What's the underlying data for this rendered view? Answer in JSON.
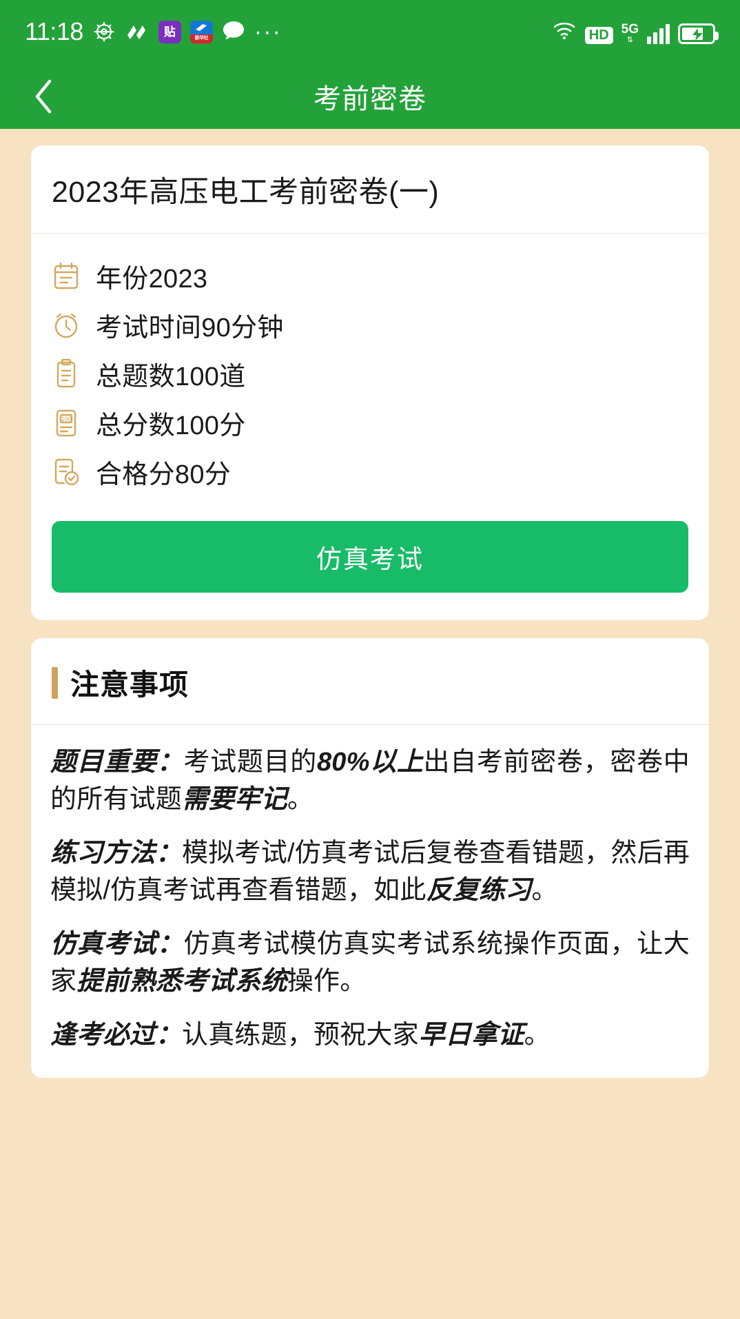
{
  "status_bar": {
    "time": "11:18",
    "left_icons": [
      {
        "name": "gear-icon",
        "label": ""
      },
      {
        "name": "app-squiggle-icon",
        "label": ""
      },
      {
        "name": "app-tie-icon",
        "label": "贴"
      },
      {
        "name": "app-blue-icon",
        "label": "新华社"
      },
      {
        "name": "chat-bubble-icon",
        "label": ""
      },
      {
        "name": "more-dots-icon",
        "label": "···"
      }
    ],
    "right": {
      "wifi": "wifi-icon",
      "hd_badge": "HD",
      "network_type": "5G",
      "signal_bars": 4,
      "battery": "charging"
    }
  },
  "nav": {
    "back_icon": "chevron-left-icon",
    "title": "考前密卷"
  },
  "paper_card": {
    "title": "2023年高压电工考前密卷(一)",
    "info_rows": [
      {
        "icon": "calendar-icon",
        "text": "年份2023"
      },
      {
        "icon": "alarm-clock-icon",
        "text": "考试时间90分钟"
      },
      {
        "icon": "clipboard-icon",
        "text": "总题数100道"
      },
      {
        "icon": "score-document-icon",
        "text": "总分数100分"
      },
      {
        "icon": "document-check-icon",
        "text": "合格分80分"
      }
    ],
    "action_button": "仿真考试"
  },
  "notes": {
    "title": "注意事项",
    "paragraphs": [
      {
        "lead": "题目重要：",
        "parts": [
          {
            "text": "考试题目的",
            "bold": false
          },
          {
            "text": "80%以上",
            "bold": true
          },
          {
            "text": "出自考前密卷，密卷中的所有试题",
            "bold": false
          },
          {
            "text": "需要牢记",
            "bold": true
          },
          {
            "text": "。",
            "bold": false
          }
        ]
      },
      {
        "lead": "练习方法：",
        "parts": [
          {
            "text": "模拟考试/仿真考试后复卷查看错题，然后再模拟/仿真考试再查看错题，如此",
            "bold": false
          },
          {
            "text": "反复练习",
            "bold": true
          },
          {
            "text": "。",
            "bold": false
          }
        ]
      },
      {
        "lead": "仿真考试：",
        "parts": [
          {
            "text": "仿真考试模仿真实考试系统操作页面，让大家",
            "bold": false
          },
          {
            "text": "提前熟悉考试系统",
            "bold": true
          },
          {
            "text": "操作。",
            "bold": false
          }
        ]
      },
      {
        "lead": "逢考必过：",
        "parts": [
          {
            "text": "认真练题，预祝大家",
            "bold": false
          },
          {
            "text": "早日拿证",
            "bold": true
          },
          {
            "text": "。",
            "bold": false
          }
        ]
      }
    ]
  },
  "colors": {
    "header_green": "#23A23A",
    "button_green": "#18BC68",
    "page_background": "#F7E2C2",
    "icon_gold": "#D2A85E",
    "accent_gold": "#CFA15E"
  }
}
